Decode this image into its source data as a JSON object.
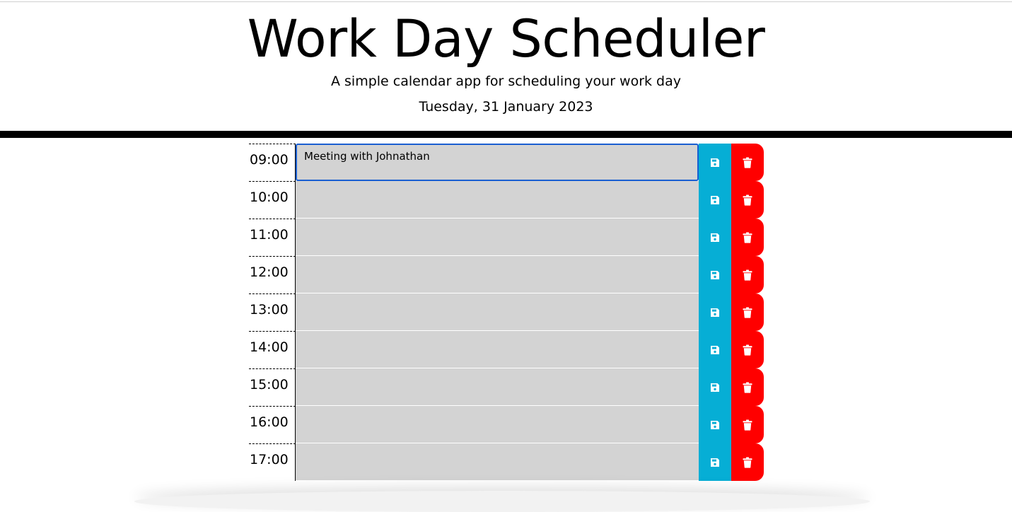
{
  "header": {
    "title": "Work Day Scheduler",
    "subtitle": "A simple calendar app for scheduling your work day",
    "current_day": "Tuesday, 31 January 2023"
  },
  "colors": {
    "save": "#06aed5",
    "delete": "#ff0000",
    "past": "#d3d3d3",
    "focus": "#1a5fd1"
  },
  "icons": {
    "save": "floppy-disk-icon",
    "delete": "trash-icon"
  },
  "time_blocks": [
    {
      "hour": "09:00",
      "text": "Meeting with Johnathan"
    },
    {
      "hour": "10:00",
      "text": ""
    },
    {
      "hour": "11:00",
      "text": ""
    },
    {
      "hour": "12:00",
      "text": ""
    },
    {
      "hour": "13:00",
      "text": ""
    },
    {
      "hour": "14:00",
      "text": ""
    },
    {
      "hour": "15:00",
      "text": ""
    },
    {
      "hour": "16:00",
      "text": ""
    },
    {
      "hour": "17:00",
      "text": ""
    }
  ]
}
